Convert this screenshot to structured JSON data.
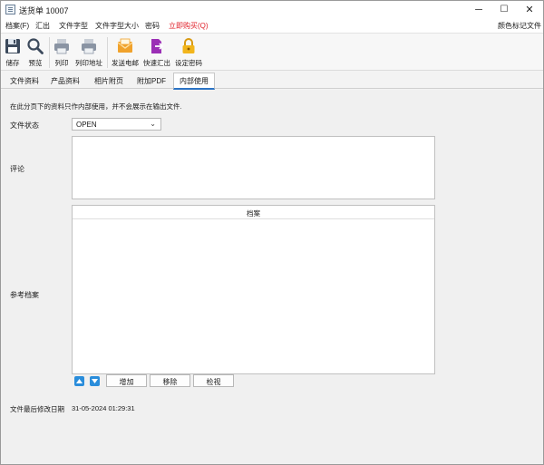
{
  "window": {
    "title": "送货单 10007",
    "minimize": "─",
    "maximize": "☐",
    "close": "✕"
  },
  "menu": {
    "items": [
      "档案(F)",
      "汇出",
      "文件字型",
      "文件字型大小",
      "密码"
    ],
    "purchase": "立即购买(Q)",
    "right": "颜色标记文件"
  },
  "toolbar": {
    "save": "储存",
    "preview": "预览",
    "print": "列印",
    "print_address": "列印地址",
    "send_email": "发送电邮",
    "quick_export": "快速汇出",
    "set_password": "设定密码"
  },
  "tabs": {
    "items": [
      "文件资料",
      "产品资料",
      "相片附页",
      "附加PDF",
      "内部使用"
    ],
    "active_index": 4
  },
  "internal": {
    "info": "在此分页下的资料只作内部使用，并不会展示在输出文件.",
    "status_label": "文件状态",
    "status_value": "OPEN",
    "comment_label": "评论",
    "reference_label": "参考档案",
    "grid_header": "档案",
    "add_button": "增加",
    "remove_button": "移除",
    "view_button": "检视",
    "modified_label": "文件最后修改日期",
    "modified_value": "31-05-2024 01:29:31"
  },
  "colors": {
    "accent": "#2b73c4",
    "purchase_red": "#e0202a",
    "arrow_blue": "#2a8ddb",
    "email_orange": "#f0a22c",
    "export_purple": "#9b2fb5",
    "lock_gold": "#f2b51c"
  },
  "icons": {
    "save": "floppy-disk-icon",
    "preview": "magnifier-icon",
    "print": "printer-icon",
    "email": "envelope-icon",
    "export": "export-icon",
    "lock": "lock-icon"
  }
}
